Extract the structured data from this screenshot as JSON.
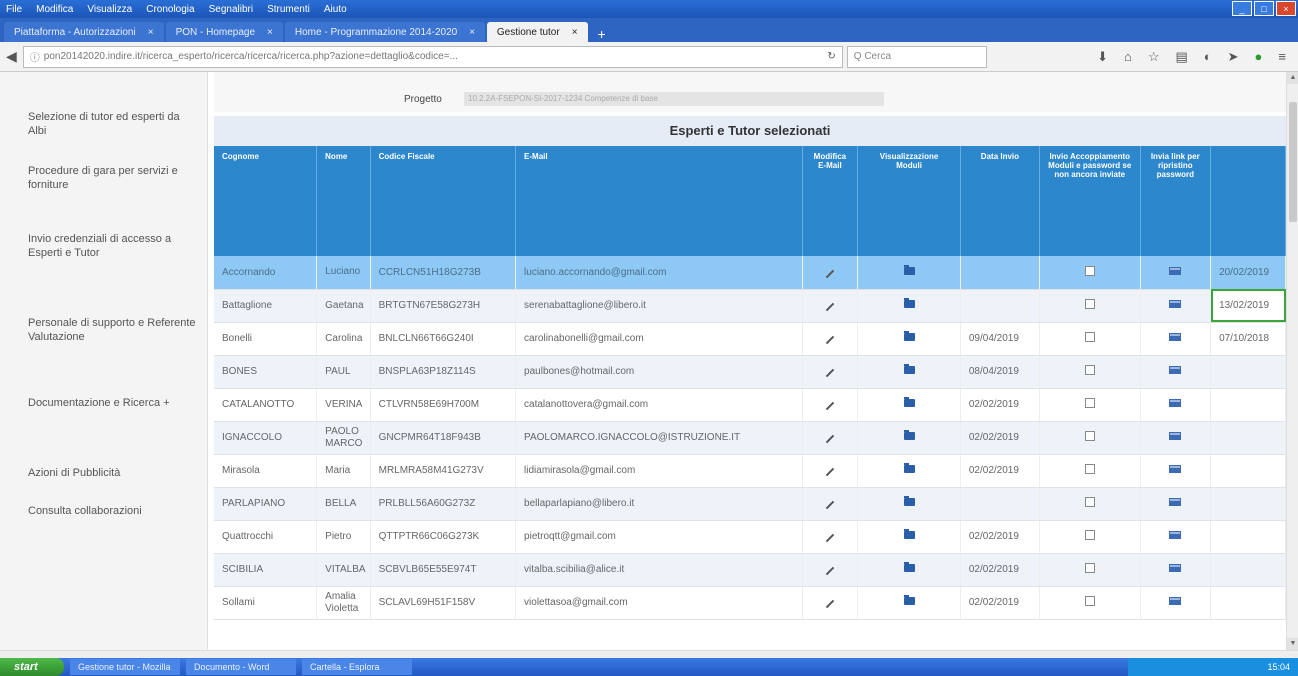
{
  "window": {
    "menu": [
      "File",
      "Modifica",
      "Visualizza",
      "Cronologia",
      "Segnalibri",
      "Strumenti",
      "Aiuto"
    ]
  },
  "tabs": [
    {
      "label": "Piattaforma - Autorizzazioni",
      "active": false
    },
    {
      "label": "PON - Homepage",
      "active": false
    },
    {
      "label": "Home - Programmazione 2014-2020",
      "active": false
    },
    {
      "label": "Gestione tutor",
      "active": true
    }
  ],
  "navbar": {
    "url": "pon20142020.indire.it/ricerca_esperto/ricerca/ricerca/ricerca.php?azione=dettaglio&codice=...",
    "search_placeholder": "Q Cerca"
  },
  "sidebar": {
    "items": [
      {
        "label": "Selezione di tutor ed esperti da Albi"
      },
      {
        "label": "Procedure di gara per servizi e forniture"
      },
      {
        "label": "Invio credenziali di accesso a Esperti e Tutor"
      },
      {
        "label": "Personale di supporto e Referente Valutazione"
      },
      {
        "label": "Documentazione e Ricerca +"
      },
      {
        "label": "Azioni di Pubblicità"
      },
      {
        "label": "Consulta collaborazioni"
      }
    ]
  },
  "project": {
    "label": "Progetto",
    "value": "10.2.2A-FSEPON-SI-2017-1234 Competenze di base"
  },
  "section_title": "Esperti e Tutor selezionati",
  "table": {
    "headers": [
      "Cognome",
      "Nome",
      "Codice Fiscale",
      "E-Mail",
      "Modifica E-Mail",
      "Visualizzazione Moduli",
      "Data Invio",
      "Invio Accoppiamento Moduli e password se non ancora inviate",
      "Invia link per ripristino password",
      ""
    ],
    "rows": [
      {
        "cognome": "Accornando",
        "nome": "Luciano",
        "cf": "CCRLCN51H18G273B",
        "email": "luciano.accornando@gmail.com",
        "data_invio": "",
        "date2": "20/02/2019",
        "selected": true
      },
      {
        "cognome": "Battaglione",
        "nome": "Gaetana",
        "cf": "BRTGTN67E58G273H",
        "email": "serenabattaglione@libero.it",
        "data_invio": "",
        "date2": "13/02/2019",
        "selected": false
      },
      {
        "cognome": "Bonelli",
        "nome": "Carolina",
        "cf": "BNLCLN66T66G240I",
        "email": "carolinabonelli@gmail.com",
        "data_invio": "09/04/2019",
        "date2": "07/10/2018",
        "selected": false
      },
      {
        "cognome": "BONES",
        "nome": "PAUL",
        "cf": "BNSPLA63P18Z114S",
        "email": "paulbones@hotmail.com",
        "data_invio": "08/04/2019",
        "date2": "",
        "selected": false
      },
      {
        "cognome": "CATALANOTTO",
        "nome": "VERINA",
        "cf": "CTLVRN58E69H700M",
        "email": "catalanottovera@gmail.com",
        "data_invio": "02/02/2019",
        "date2": "",
        "selected": false
      },
      {
        "cognome": "IGNACCOLO",
        "nome": "PAOLO MARCO",
        "cf": "GNCPMR64T18F943B",
        "email": "PAOLOMARCO.IGNACCOLO@ISTRUZIONE.IT",
        "data_invio": "02/02/2019",
        "date2": "",
        "selected": false
      },
      {
        "cognome": "Mirasola",
        "nome": "Maria",
        "cf": "MRLMRA58M41G273V",
        "email": "lidiamirasola@gmail.com",
        "data_invio": "02/02/2019",
        "date2": "",
        "selected": false
      },
      {
        "cognome": "PARLAPIANO",
        "nome": "BELLA",
        "cf": "PRLBLL56A60G273Z",
        "email": "bellaparlapiano@libero.it",
        "data_invio": "",
        "date2": "",
        "selected": false
      },
      {
        "cognome": "Quattrocchi",
        "nome": "Pietro",
        "cf": "QTTPTR66C06G273K",
        "email": "pietroqtt@gmail.com",
        "data_invio": "02/02/2019",
        "date2": "",
        "selected": false
      },
      {
        "cognome": "SCIBILIA",
        "nome": "VITALBA",
        "cf": "SCBVLB65E55E974T",
        "email": "vitalba.scibilia@alice.it",
        "data_invio": "02/02/2019",
        "date2": "",
        "selected": false
      },
      {
        "cognome": "Sollami",
        "nome": "Amalia Violetta",
        "cf": "SCLAVL69H51F158V",
        "email": "violettasoa@gmail.com",
        "data_invio": "02/02/2019",
        "date2": "",
        "selected": false
      }
    ]
  },
  "taskbar": {
    "start": "start",
    "items": [
      "Gestione tutor - Mozilla",
      "Documento - Word",
      "Cartella - Esplora"
    ],
    "clock": "15:04"
  },
  "colors": {
    "header_blue": "#2d87cc",
    "selected_row": "#8ec8f4",
    "row_stripe": "#eef3fa"
  }
}
